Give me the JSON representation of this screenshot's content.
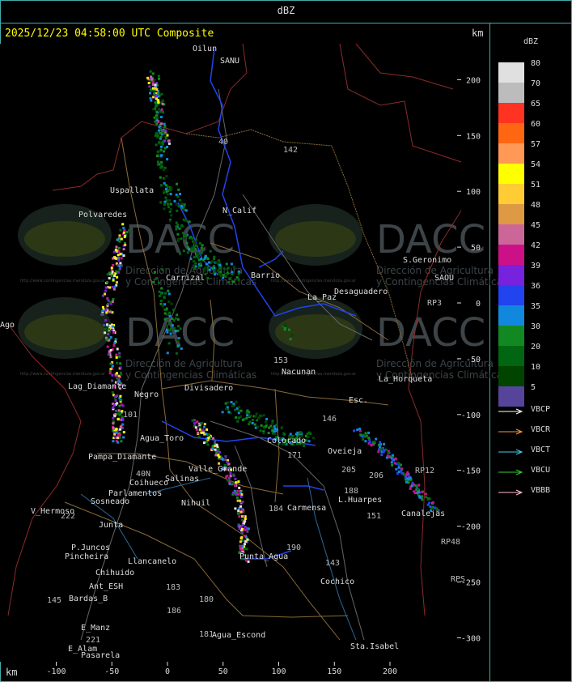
{
  "header": {
    "title": "dBZ"
  },
  "map": {
    "timestamp": "2025/12/23 04:58:00 UTC Composite",
    "unit_label": "km",
    "x_ticks": [
      "-100",
      "-50",
      "0",
      "50",
      "100",
      "150",
      "200"
    ],
    "y_ticks": [
      "200",
      "150",
      "100",
      "50",
      "0",
      "-50",
      "-100",
      "-150",
      "-200",
      "-250",
      "-300"
    ],
    "places": [
      "Oilun",
      "SANU",
      "Uspallata",
      "Polvaredes",
      "N_Calif",
      "S.Geronimo",
      "SAOU",
      "Desaguadero",
      "Carrizal",
      "Barrio",
      "La_Paz",
      "Nacunan",
      "La_Horqueta",
      "Lag_Diamante",
      "Divisadero",
      "Esc.",
      "Agua_Toro",
      "Pampa_Diamante",
      "Oveieja",
      "Canalejas",
      "Salinas",
      "Valle_Grande",
      "Parlamentos",
      "Sosneado",
      "Nihuil",
      "Colorado",
      "Carmensa",
      "L.Huarpes",
      "V_Hermoso",
      "Punta_Agua",
      "Ant_ESH",
      "P.Juncos",
      "Pincheira",
      "Llancanelo",
      "Chihuido",
      "Bardas_B",
      "E_Manz",
      "E_Alam",
      "Pasarela",
      "Agua_Escond",
      "Cochico",
      "Sta.Isabel",
      "Negro",
      "Coihueco",
      "Ago",
      "Junta"
    ],
    "routes": [
      "40",
      "142",
      "153",
      "146",
      "151",
      "171",
      "184",
      "190",
      "143",
      "145",
      "188",
      "205",
      "206",
      "180",
      "181",
      "221",
      "222",
      "186",
      "183",
      "RP3",
      "RP12",
      "RP48",
      "RPS",
      "101",
      "40N"
    ],
    "watermark": {
      "text": "DACC",
      "subtitle_1": "Dirección de Agricultura",
      "subtitle_2": "y Contingencias Climáticas",
      "url": "http://www.contingencias.mendoza.gov.ar"
    }
  },
  "legend": {
    "title": "dBZ",
    "levels": [
      {
        "value": "80",
        "color": "#e0e0e0"
      },
      {
        "value": "70",
        "color": "#bcbcbc"
      },
      {
        "value": "65",
        "color": "#ff3322"
      },
      {
        "value": "60",
        "color": "#ff6611"
      },
      {
        "value": "57",
        "color": "#ff9955"
      },
      {
        "value": "54",
        "color": "#ffff00"
      },
      {
        "value": "51",
        "color": "#ffcc33"
      },
      {
        "value": "48",
        "color": "#dd9944"
      },
      {
        "value": "45",
        "color": "#cc6699"
      },
      {
        "value": "42",
        "color": "#cc1188"
      },
      {
        "value": "39",
        "color": "#7722dd"
      },
      {
        "value": "36",
        "color": "#2244ee"
      },
      {
        "value": "35",
        "color": "#1188dd"
      },
      {
        "value": "30",
        "color": "#118822"
      },
      {
        "value": "20",
        "color": "#006611"
      },
      {
        "value": "10",
        "color": "#004400"
      },
      {
        "value": "5",
        "color": "#554499"
      }
    ],
    "radars": [
      {
        "name": "VBCP",
        "color": "#ffffff"
      },
      {
        "name": "VBCR",
        "color": "#ff9933"
      },
      {
        "name": "VBCT",
        "color": "#44ccee"
      },
      {
        "name": "VBCU",
        "color": "#33cc33"
      },
      {
        "name": "VBBB",
        "color": "#ffbbcc"
      }
    ]
  }
}
